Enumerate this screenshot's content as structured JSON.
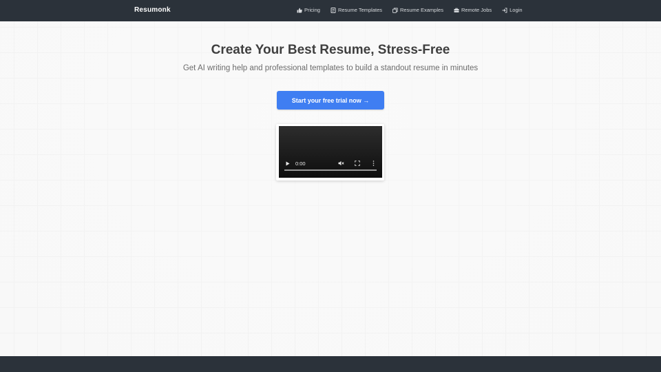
{
  "navbar": {
    "brand": "Resumonk",
    "links": [
      {
        "label": "Pricing",
        "icon": "thumbs-up-icon"
      },
      {
        "label": "Resume Templates",
        "icon": "document-icon"
      },
      {
        "label": "Resume Examples",
        "icon": "copy-icon"
      },
      {
        "label": "Remote Jobs",
        "icon": "briefcase-icon"
      },
      {
        "label": "Login",
        "icon": "sign-in-icon"
      }
    ]
  },
  "hero": {
    "title": "Create Your Best Resume, Stress-Free",
    "subtitle": "Get AI writing help and professional templates to build a standout resume in minutes",
    "cta_label": "Start your free trial now →"
  },
  "video": {
    "time": "0:00",
    "progress": 0
  },
  "colors": {
    "navbar_bg": "#2b323a",
    "accent": "#3f7ef2",
    "page_bg": "#f8f8f8"
  }
}
